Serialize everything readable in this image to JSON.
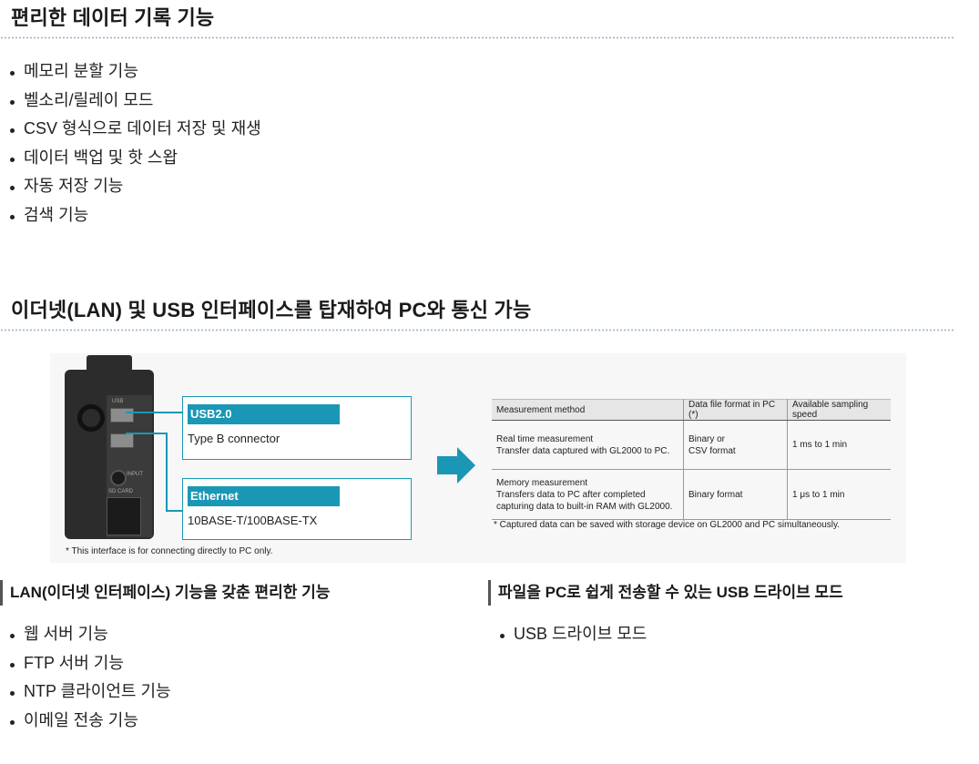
{
  "section1": {
    "title": "편리한 데이터 기록 기능",
    "items": [
      "메모리 분할 기능",
      "벨소리/릴레이 모드",
      "CSV 형식으로 데이터 저장 및 재생",
      "데이터 백업 및 핫 스왑",
      "자동 저장 기능",
      "검색 기능"
    ]
  },
  "section2": {
    "title": "이더넷(LAN) 및 USB 인터페이스를 탑재하여 PC와 통신 가능"
  },
  "figure": {
    "device_labels": {
      "usb": "USB",
      "input": "INPUT",
      "sd": "SD CARD"
    },
    "usb_box": {
      "title": "USB2.0",
      "subtitle": "Type B connector"
    },
    "ethernet_box": {
      "title": "Ethernet",
      "subtitle": "10BASE-T/100BASE-TX"
    },
    "left_note": "* This interface is for connecting directly to PC only.",
    "table": {
      "headers": [
        "Measurement method",
        "Data file format in PC (*)",
        "Available sampling speed"
      ],
      "rows": [
        {
          "method_line1": "Real time measurement",
          "method_line2": "Transfer data captured with GL2000 to PC.",
          "format_line1": "Binary or",
          "format_line2": "CSV format",
          "speed": "1 ms to 1 min"
        },
        {
          "method_line1": "Memory measurement",
          "method_line2": "Transfers data to PC after completed",
          "method_line3": "capturing data to built-in RAM with GL2000.",
          "format": "Binary format",
          "speed": "1 μs to 1 min"
        }
      ],
      "note": "* Captured data can be saved with storage device on GL2000 and PC simultaneously."
    },
    "colors": {
      "accent": "#1a97b5"
    }
  },
  "lan": {
    "title": "LAN(이더넷 인터페이스) 기능을 갖춘 편리한 기능",
    "items": [
      "웹 서버 기능",
      "FTP 서버 기능",
      "NTP 클라이언트 기능",
      "이메일 전송 기능"
    ]
  },
  "usb_drive": {
    "title": "파일을 PC로 쉽게 전송할 수 있는 USB 드라이브 모드",
    "items": [
      "USB 드라이브 모드"
    ]
  }
}
